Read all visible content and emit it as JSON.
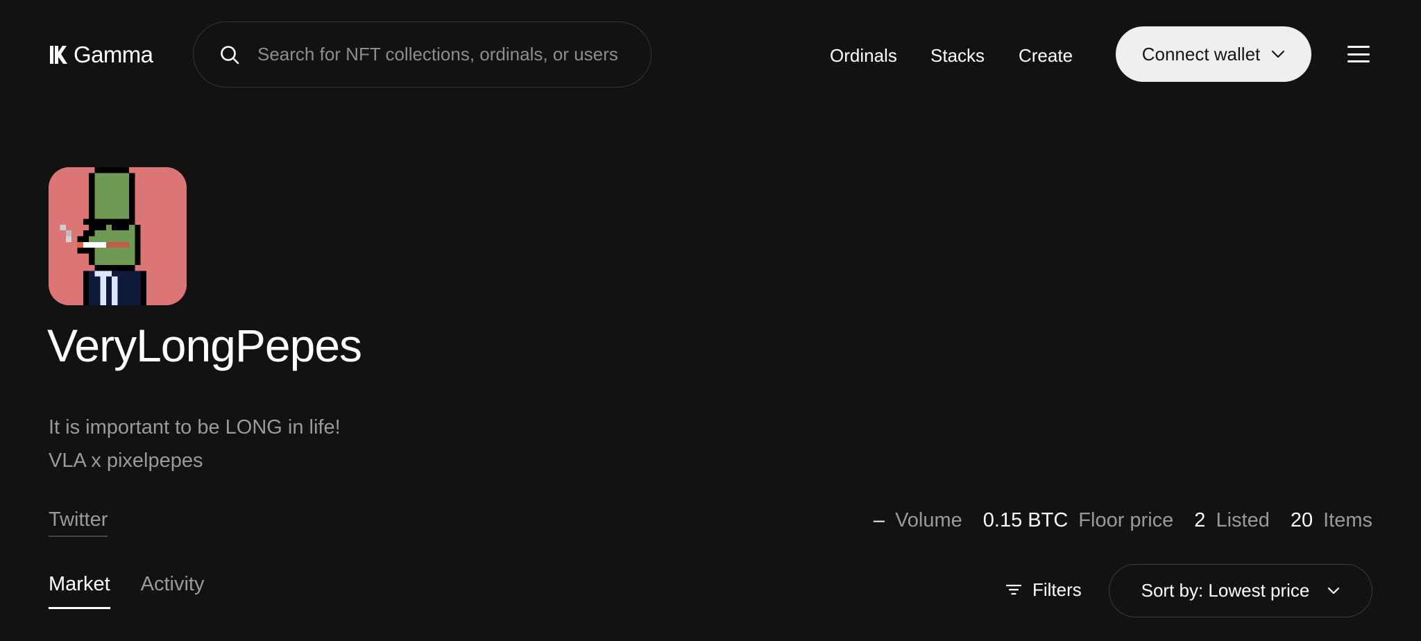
{
  "header": {
    "logo_text": "Gamma",
    "search": {
      "placeholder": "Search for NFT collections, ordinals, or users",
      "value": ""
    },
    "nav": {
      "ordinals": "Ordinals",
      "stacks": "Stacks",
      "create": "Create"
    },
    "connect_wallet_label": "Connect wallet",
    "icons": {
      "logo": "gamma-logo-icon",
      "search": "search-icon",
      "chevron": "chevron-down-icon",
      "menu": "menu-icon"
    }
  },
  "collection": {
    "name": "VeryLongPepes",
    "avatar_icon": "pepe-avatar-icon",
    "avatar_bg": "#dc7575",
    "description_lines": [
      "It is important to be LONG in life!",
      "VLA x pixelpepes"
    ],
    "twitter_label": "Twitter",
    "stats": [
      {
        "value": "–",
        "label": "Volume"
      },
      {
        "value": "0.15 BTC",
        "label": "Floor price"
      },
      {
        "value": "2",
        "label": "Listed"
      },
      {
        "value": "20",
        "label": "Items"
      }
    ]
  },
  "tabs": [
    {
      "label": "Market",
      "active": true
    },
    {
      "label": "Activity",
      "active": false
    }
  ],
  "toolbar": {
    "filters_label": "Filters",
    "filters_icon": "filter-icon",
    "sort_label": "Sort by: Lowest price"
  },
  "colors": {
    "background": "#121212",
    "text_primary": "#ffffff",
    "text_secondary": "#9a9a9a",
    "button_light": "#efefef",
    "border": "#353535"
  }
}
